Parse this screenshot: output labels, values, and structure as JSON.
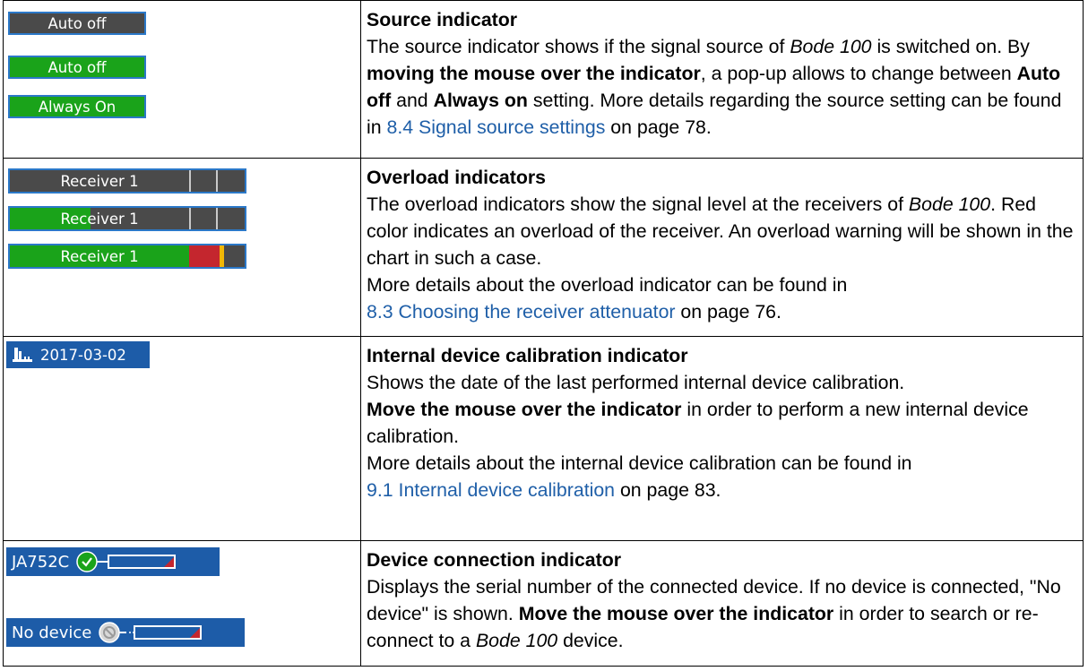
{
  "rows": [
    {
      "title": "Source indicator",
      "images": [
        "Auto off",
        "Auto off",
        "Always On"
      ],
      "text": {
        "p1": "The source indicator shows if the signal source of ",
        "bode": "Bode 100",
        "p2": " is switched on. By ",
        "b1": "moving the mouse over the indicator",
        "p3": ", a pop-up allows to change between ",
        "b2": "Auto off",
        "p4": " and ",
        "b3": "Always on",
        "p5": " setting. More details regarding the source setting can be found in ",
        "link": "8.4 Signal source settings",
        "p6": " on page 78."
      }
    },
    {
      "title": "Overload indicators",
      "images": [
        "Receiver 1",
        "Receiver 1",
        "Receiver 1"
      ],
      "text": {
        "p1": "The overload indicators show the signal level at the receivers of ",
        "bode": "Bode 100",
        "p2": ". Red color indicates an overload of the receiver. An overload warning will be shown in the chart in such a case.",
        "p3": "More details about the overload indicator can be found in ",
        "link": "8.3 Choosing the receiver attenuator",
        "p4": " on page 76."
      }
    },
    {
      "title": "Internal device calibration indicator",
      "images": [
        "2017-03-02"
      ],
      "text": {
        "p1": "Shows the date of the last performed internal device calibration.",
        "b1": "Move the mouse over the indicator",
        "p2": " in order to perform a new internal device calibration.",
        "p3": "More details about the internal device calibration can be found in ",
        "link": "9.1 Internal device calibration",
        "p4": " on page 83."
      }
    },
    {
      "title": "Device connection indicator",
      "images": [
        "JA752C",
        "No device"
      ],
      "text": {
        "p1": "Displays the serial number of the connected device. If no device is connected, \"No device\" is shown. ",
        "b1": "Move the mouse over the indicator",
        "p2": " in order to search or re-connect to a ",
        "bode": "Bode 100",
        "p3": " device."
      }
    }
  ],
  "colors": {
    "link": "#1f5fa8",
    "indicator_gray": "#4a4a4a",
    "indicator_green": "#1aa31a",
    "indicator_border": "#2b78c8",
    "status_blue": "#1d5ca8",
    "overload_red": "#c4262e",
    "overload_yellow": "#f2b705"
  },
  "overload_levels": [
    0,
    0.45,
    1.0
  ]
}
